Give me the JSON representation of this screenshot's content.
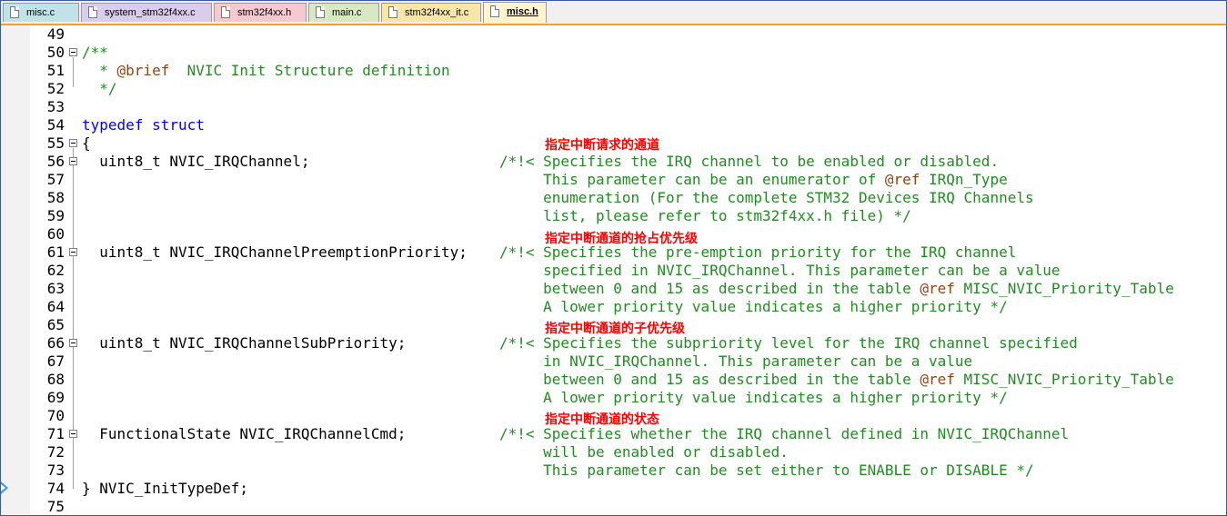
{
  "tabs": [
    {
      "label": "misc.c",
      "color": "#bfe3e6"
    },
    {
      "label": "system_stm32f4xx.c",
      "color": "#d9ccec"
    },
    {
      "label": "stm32f4xx.h",
      "color": "#f6c8d0"
    },
    {
      "label": "main.c",
      "color": "#d7e8c2"
    },
    {
      "label": "stm32f4xx_it.c",
      "color": "#f7e6a8"
    },
    {
      "label": "misc.h",
      "color": "#fff4cc",
      "active": true
    }
  ],
  "line_numbers": [
    "49",
    "50",
    "51",
    "52",
    "53",
    "54",
    "55",
    "56",
    "57",
    "58",
    "59",
    "60",
    "61",
    "62",
    "63",
    "64",
    "65",
    "66",
    "67",
    "68",
    "69",
    "70",
    "71",
    "72",
    "73",
    "74",
    "75"
  ],
  "code": {
    "l50": "/**",
    "l51_star": "  * ",
    "l51_tag": "@brief",
    "l51_rest": "  NVIC Init Structure definition",
    "l52": "  */",
    "l54_kw1": "typedef",
    "l54_kw2": "struct",
    "l55": "{",
    "l56": "  uint8_t NVIC_IRQChannel;",
    "l61": "  uint8_t NVIC_IRQChannelPreemptionPriority;",
    "l66": "  uint8_t NVIC_IRQChannelSubPriority;",
    "l71": "  FunctionalState NVIC_IRQChannelCmd;",
    "l74": "} NVIC_InitTypeDef;"
  },
  "comments": {
    "c56": "/*!< Specifies the IRQ channel to be enabled or disabled.",
    "c57_a": "     This parameter can be an enumerator of ",
    "c57_tag": "@ref",
    "c57_b": " IRQn_Type",
    "c58": "     enumeration (For the complete STM32 Devices IRQ Channels",
    "c59": "     list, please refer to stm32f4xx.h file) */",
    "c61": "/*!< Specifies the pre-emption priority for the IRQ channel",
    "c62": "     specified in NVIC_IRQChannel. This parameter can be a value",
    "c63_a": "     between 0 and 15 as described in the table ",
    "c63_tag": "@ref",
    "c63_b": " MISC_NVIC_Priority_Table",
    "c64": "     A lower priority value indicates a higher priority */",
    "c66": "/*!< Specifies the subpriority level for the IRQ channel specified",
    "c67": "     in NVIC_IRQChannel. This parameter can be a value",
    "c68_a": "     between 0 and 15 as described in the table ",
    "c68_tag": "@ref",
    "c68_b": " MISC_NVIC_Priority_Table",
    "c69": "     A lower priority value indicates a higher priority */",
    "c71": "/*!< Specifies whether the IRQ channel defined in NVIC_IRQChannel",
    "c72": "     will be enabled or disabled.",
    "c73": "     This parameter can be set either to ENABLE or DISABLE */"
  },
  "annotations": {
    "a1": "指定中断请求的通道",
    "a2": "指定中断通道的抢占优先级",
    "a3": "指定中断通道的子优先级",
    "a4": "指定中断通道的状态"
  },
  "colors": {
    "keyword": "#0000ff",
    "comment": "#228b22",
    "doc_tag": "#8b4513",
    "annotation": "#ff0000",
    "active_tab_underline": "#f0a030"
  }
}
